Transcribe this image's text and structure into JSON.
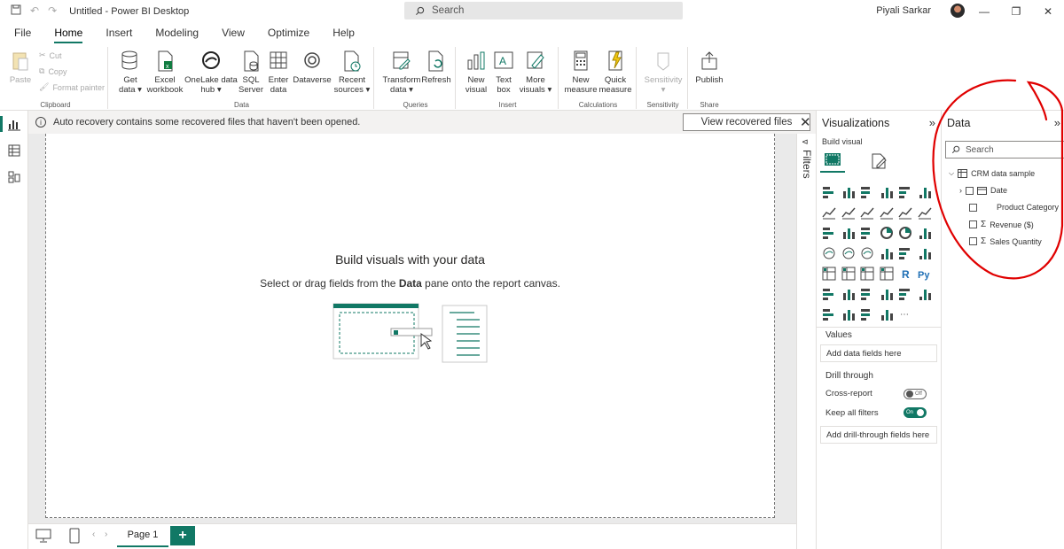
{
  "titlebar": {
    "title": "Untitled - Power BI Desktop",
    "search_placeholder": "Search",
    "user": "Piyali Sarkar"
  },
  "menu": {
    "tabs": [
      "File",
      "Home",
      "Insert",
      "Modeling",
      "View",
      "Optimize",
      "Help"
    ],
    "active": "Home"
  },
  "ribbon": {
    "clipboard": {
      "label": "Clipboard",
      "paste": "Paste",
      "cut": "Cut",
      "copy": "Copy",
      "format_painter": "Format painter"
    },
    "data": {
      "label": "Data",
      "get_data": [
        "Get",
        "data ▾"
      ],
      "excel": [
        "Excel",
        "workbook"
      ],
      "onelake": [
        "OneLake data",
        "hub ▾"
      ],
      "sql": [
        "SQL",
        "Server"
      ],
      "enter": [
        "Enter",
        "data"
      ],
      "dataverse": [
        "Dataverse",
        ""
      ],
      "recent": [
        "Recent",
        "sources ▾"
      ]
    },
    "queries": {
      "label": "Queries",
      "transform": [
        "Transform",
        "data ▾"
      ],
      "refresh": [
        "Refresh",
        ""
      ]
    },
    "insert": {
      "label": "Insert",
      "new_visual": [
        "New",
        "visual"
      ],
      "text_box": [
        "Text",
        "box"
      ],
      "more_visuals": [
        "More",
        "visuals ▾"
      ]
    },
    "calculations": {
      "label": "Calculations",
      "new_measure": [
        "New",
        "measure"
      ],
      "quick_measure": [
        "Quick",
        "measure"
      ]
    },
    "sensitivity": {
      "label": "Sensitivity",
      "sensitivity": [
        "Sensitivity",
        "▾"
      ]
    },
    "share": {
      "label": "Share",
      "publish": [
        "Publish",
        ""
      ]
    }
  },
  "notice": {
    "text": "Auto recovery contains some recovered files that haven't been opened.",
    "button": "View recovered files"
  },
  "canvas": {
    "title": "Build visuals with your data",
    "subtitle_pre": "Select or drag fields from the ",
    "subtitle_bold": "Data",
    "subtitle_post": " pane onto the report canvas."
  },
  "bottom": {
    "page_tab": "Page 1",
    "add": "+"
  },
  "filters": {
    "label": "Filters"
  },
  "visualizations": {
    "title": "Visualizations",
    "build_visual": "Build visual",
    "values_label": "Values",
    "values_drop": "Add data fields here",
    "drill_label": "Drill through",
    "cross_report": "Cross-report",
    "cross_report_state": "Off",
    "keep_filters": "Keep all filters",
    "keep_filters_state": "On",
    "drill_drop": "Add drill-through fields here"
  },
  "data_pane": {
    "title": "Data",
    "search_placeholder": "Search",
    "table": "CRM data sample",
    "fields": [
      {
        "name": "Date",
        "kind": "date",
        "expandable": true
      },
      {
        "name": "Product Category",
        "kind": "text",
        "expandable": false
      },
      {
        "name": "Revenue ($)",
        "kind": "sum",
        "expandable": false
      },
      {
        "name": "Sales Quantity",
        "kind": "sum",
        "expandable": false
      }
    ]
  },
  "colors": {
    "accent": "#117865",
    "annotation": "#e00000"
  }
}
